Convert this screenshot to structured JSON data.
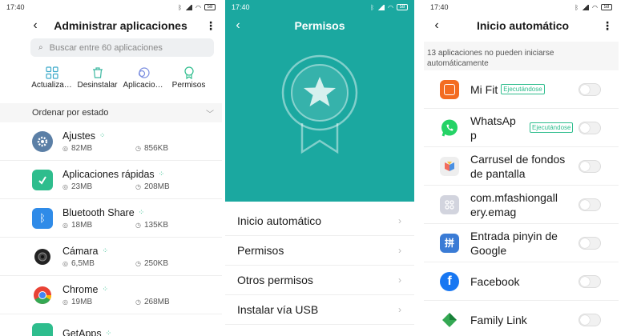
{
  "status": {
    "time": "17:40",
    "battery": "58"
  },
  "app_manager": {
    "title": "Administrar aplicaciones",
    "search_placeholder": "Buscar entre 60 aplicaciones",
    "tools": [
      {
        "label": "Actualiza…",
        "icon": "grid-icon"
      },
      {
        "label": "Desinstalar",
        "icon": "trash-icon"
      },
      {
        "label": "Aplicacio…",
        "icon": "overlap-circles-icon"
      },
      {
        "label": "Permisos",
        "icon": "badge-icon"
      }
    ],
    "sort_label": "Ordenar por estado",
    "apps": [
      {
        "name": "Ajustes",
        "storage": "82MB",
        "data": "856KB",
        "icon_color": "#5b7fa6"
      },
      {
        "name": "Aplicaciones rápidas",
        "storage": "23MB",
        "data": "208MB",
        "icon_color": "#2ebd8d"
      },
      {
        "name": "Bluetooth Share",
        "storage": "18MB",
        "data": "135KB",
        "icon_color": "#2f8be8"
      },
      {
        "name": "Cámara",
        "storage": "6,5MB",
        "data": "250KB",
        "icon_color": "#222222"
      },
      {
        "name": "Chrome",
        "storage": "19MB",
        "data": "268MB",
        "icon_color": "#e94235"
      },
      {
        "name": "GetApps",
        "storage": "",
        "data": "",
        "icon_color": "#2ebd8d"
      }
    ]
  },
  "permissions": {
    "title": "Permisos",
    "accent": "#1ba8a0",
    "items": [
      "Inicio automático",
      "Permisos",
      "Otros permisos",
      "Instalar vía USB"
    ]
  },
  "autostart": {
    "title": "Inicio automático",
    "notice": "13 aplicaciones no pueden iniciarse automáticamente",
    "running_label": "Ejecutándose",
    "apps": [
      {
        "name": "Mi Fit",
        "running": true,
        "icon_color": "#f36c21"
      },
      {
        "name": "WhatsAp p",
        "running": true,
        "icon_color": "#25d366"
      },
      {
        "name": "Carrusel de fondos de pantalla",
        "running": false,
        "icon_color": "#e5e5e5"
      },
      {
        "name": "com.mfashiongall ery.emag",
        "running": false,
        "icon_color": "#c9cbd6"
      },
      {
        "name": "Entrada pinyin de Google",
        "running": false,
        "icon_color": "#3a7bd5"
      },
      {
        "name": "Facebook",
        "running": false,
        "icon_color": "#1877f2"
      },
      {
        "name": "Family Link",
        "running": false,
        "icon_color": "#34a853"
      }
    ]
  }
}
